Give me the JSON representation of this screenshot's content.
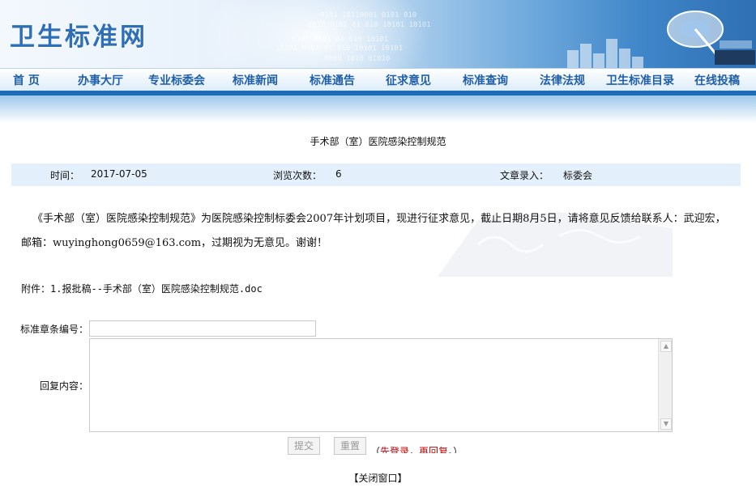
{
  "site": {
    "logo_text": "卫生标准网"
  },
  "banner": {
    "digits": [
      "0101 10110001 0101 010",
      "1010 0101 01 010 10101 10101",
      "0101 0101 01 010 10101",
      "10101 0101 01 010 10101 10101",
      "0000 1010 01010"
    ]
  },
  "nav": {
    "items": [
      {
        "label": "首 页"
      },
      {
        "label": "办事大厅"
      },
      {
        "label": "专业标委会"
      },
      {
        "label": "标准新闻"
      },
      {
        "label": "标准通告"
      },
      {
        "label": "征求意见"
      },
      {
        "label": "标准查询"
      },
      {
        "label": "法律法规"
      },
      {
        "label": "卫生标准目录"
      },
      {
        "label": "在线投稿"
      }
    ]
  },
  "article": {
    "title": "手术部（室）医院感染控制规范",
    "meta": {
      "time_label": "时间：",
      "time_value": "2017-07-05",
      "views_label": "浏览次数：",
      "views_value": "6",
      "author_label": "文章录入：",
      "author_value": "标委会"
    },
    "body": "《手术部（室）医院感染控制规范》为医院感染控制标委会2007年计划项目，现进行征求意见，截止日期8月5日，请将意见反馈给联系人：武迎宏，邮箱：wuyinghong0659@163.com，过期视为无意见。谢谢！",
    "attachment_label": "附件：",
    "attachment_file": "1.报批稿--手术部（室）医院感染控制规范.doc"
  },
  "form": {
    "clause_label": "标准章条编号：",
    "reply_label": "回复内容：",
    "submit_label": "提交",
    "reset_label": "重置",
    "hint_open": "（",
    "hint_login": "先登录",
    "hint_sep": "，",
    "hint_reply": "再回复",
    "hint_close": "。）"
  },
  "footer": {
    "close_label": "【关闭窗口】"
  },
  "colors": {
    "nav_text": "#1f5ea8",
    "accent_bar": "#1b6cb7",
    "meta_bg": "#e3f0fb",
    "login_hint": "#c00000"
  }
}
